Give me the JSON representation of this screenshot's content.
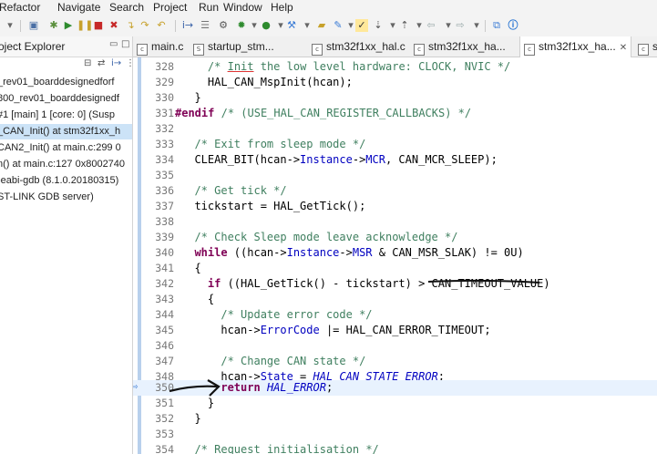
{
  "menu": [
    "Refactor",
    "Navigate",
    "Search",
    "Project",
    "Run",
    "Window",
    "Help"
  ],
  "explorer": {
    "title": "oject Explorer",
    "rows": [
      {
        "text": "_rev01_boarddesignedforf",
        "selected": false
      },
      {
        "text": "800_rev01_boarddesignedf",
        "selected": false
      },
      {
        "text": "#1 [main] 1 [core: 0] (Susp",
        "selected": false
      },
      {
        "text": "_CAN_Init() at stm32f1xx_h",
        "selected": true
      },
      {
        "text": "CAN2_Init() at main.c:299 0",
        "selected": false
      },
      {
        "text": "n() at main.c:127 0x8002740",
        "selected": false
      },
      {
        "text": "-eabi-gdb (8.1.0.20180315)",
        "selected": false
      },
      {
        "text": "ST-LINK GDB server)",
        "selected": false
      }
    ]
  },
  "tabs": [
    {
      "label": "main.c",
      "active": false
    },
    {
      "label": "startup_stm...",
      "active": false
    },
    {
      "label": "stm32f1xx_hal.c",
      "active": false
    },
    {
      "label": "stm32f1xx_ha...",
      "active": false
    },
    {
      "label": "stm32f1xx_ha...",
      "active": true
    },
    {
      "label": "st",
      "active": false
    }
  ],
  "editor": {
    "current_line": 350,
    "lines": [
      {
        "n": "328",
        "text": "    /* Init the low level hardware: CLOCK, NVIC */"
      },
      {
        "n": "329",
        "text": "    HAL_CAN_MspInit(hcan);"
      },
      {
        "n": "330",
        "text": "  }"
      },
      {
        "n": "331",
        "text": "#endif /* (USE_HAL_CAN_REGISTER_CALLBACKS) */"
      },
      {
        "n": "332",
        "text": ""
      },
      {
        "n": "333",
        "text": "  /* Exit from sleep mode */"
      },
      {
        "n": "334",
        "text": "  CLEAR_BIT(hcan->Instance->MCR, CAN_MCR_SLEEP);"
      },
      {
        "n": "335",
        "text": ""
      },
      {
        "n": "336",
        "text": "  /* Get tick */"
      },
      {
        "n": "337",
        "text": "  tickstart = HAL_GetTick();"
      },
      {
        "n": "338",
        "text": ""
      },
      {
        "n": "339",
        "text": "  /* Check Sleep mode leave acknowledge */"
      },
      {
        "n": "340",
        "text": "  while ((hcan->Instance->MSR & CAN_MSR_SLAK) != 0U)"
      },
      {
        "n": "341",
        "text": "  {"
      },
      {
        "n": "342",
        "text": "    if ((HAL_GetTick() - tickstart) > CAN_TIMEOUT_VALUE)"
      },
      {
        "n": "343",
        "text": "    {"
      },
      {
        "n": "344",
        "text": "      /* Update error code */"
      },
      {
        "n": "345",
        "text": "      hcan->ErrorCode |= HAL_CAN_ERROR_TIMEOUT;"
      },
      {
        "n": "346",
        "text": ""
      },
      {
        "n": "347",
        "text": "      /* Change CAN state */"
      },
      {
        "n": "348",
        "text": "      hcan->State = HAL_CAN_STATE_ERROR;"
      },
      {
        "n": "349",
        "text": ""
      },
      {
        "n": "350",
        "text": "      return HAL_ERROR;"
      },
      {
        "n": "351",
        "text": "    }"
      },
      {
        "n": "352",
        "text": "  }"
      },
      {
        "n": "353",
        "text": ""
      },
      {
        "n": "354",
        "text": "  /* Request initialisation */"
      }
    ]
  },
  "colors": {
    "comment": "#3f7f5f",
    "keyword": "#7f0055",
    "field": "#0000c0",
    "current_line_bg": "#e8f2fe",
    "selection_bg": "#cce3f7"
  },
  "icons": [
    "new-file-icon",
    "save-icon",
    "debug-icon",
    "resume-icon",
    "suspend-icon",
    "terminate-icon",
    "disconnect-icon",
    "step-into-icon",
    "step-over-icon",
    "step-return-icon",
    "run-icon",
    "build-icon",
    "search-icon",
    "info-icon"
  ]
}
